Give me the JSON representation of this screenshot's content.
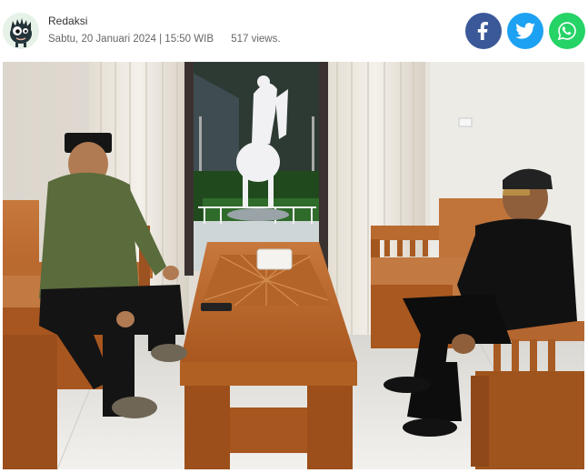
{
  "article": {
    "author": "Redaksi",
    "date": "Sabtu, 20 Januari 2024 | 15:50 WIB",
    "views": "517 views."
  },
  "share": {
    "facebook_icon": "facebook-icon",
    "twitter_icon": "twitter-icon",
    "whatsapp_icon": "whatsapp-icon",
    "colors": {
      "facebook": "#3b5998",
      "twitter": "#1da1f2",
      "whatsapp": "#25d366"
    }
  },
  "photo": {
    "subject": "two-men-seated-wooden-sofas-facing-each-other-across-wooden-table"
  }
}
